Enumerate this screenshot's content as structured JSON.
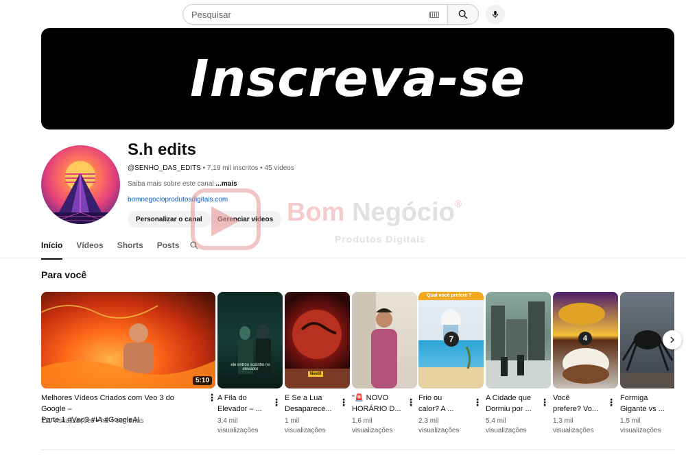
{
  "search": {
    "placeholder": "Pesquisar"
  },
  "banner": {
    "text": "Inscreva-se"
  },
  "channel": {
    "name": "S.h edits",
    "handle": "@SENHO_DAS_EDITS",
    "subscribers": "7,19 mil inscritos",
    "videos_count": "45 vídeos",
    "separator": " • ",
    "about": "Saiba mais sobre este canal ",
    "about_more": "...mais",
    "link": "bomnegocioprodutosdigitais.com",
    "customize_label": "Personalizar o canal",
    "manage_label": "Gerenciar vídeos"
  },
  "watermark": {
    "brand_part1": "Bom ",
    "brand_part2": "Negócio",
    "registered": "®",
    "subtitle": "Produtos Digitais"
  },
  "tabs": [
    "Início",
    "Vídeos",
    "Shorts",
    "Posts"
  ],
  "section": {
    "title": "Para você"
  },
  "videos": [
    {
      "title_line1": "Melhores Vídeos Criados com Veo 3 do Google –",
      "title_line2": "Parte 1 #Veo3 #IA #GoogleAI",
      "meta_line1": "111 visualizações • há 4 semanas",
      "meta_line2": "",
      "duration": "5:10"
    },
    {
      "title_line1": "A Fila do",
      "title_line2": "Elevador – ...",
      "meta_line1": "3,4 mil",
      "meta_line2": "visualizações",
      "overlay": "ele entrou sozinho no elevador"
    },
    {
      "title_line1": "E Se a Lua",
      "title_line2": "Desaparece...",
      "meta_line1": "1 mil",
      "meta_line2": "visualizações",
      "overlay": "Nestil"
    },
    {
      "title_line1": "\"🚨 NOVO",
      "title_line2": "HORÁRIO D...",
      "meta_line1": "1,6 mil",
      "meta_line2": "visualizações"
    },
    {
      "title_line1": "Frio ou",
      "title_line2": "calor? A ...",
      "meta_line1": "2,3 mil",
      "meta_line2": "visualizações",
      "overlay": "Qual você prefere ?",
      "number": "7"
    },
    {
      "title_line1": "A Cidade que",
      "title_line2": "Dormiu por ...",
      "meta_line1": "5,4 mil",
      "meta_line2": "visualizações"
    },
    {
      "title_line1": "Você",
      "title_line2": "prefere? Vo...",
      "meta_line1": "1,3 mil",
      "meta_line2": "visualizações",
      "number": "4"
    },
    {
      "title_line1": "Formiga",
      "title_line2": "Gigante vs ...",
      "meta_line1": "1,5 mil",
      "meta_line2": "visualizações"
    }
  ],
  "colors": {
    "accent_link": "#065fd4",
    "banner_bg": "#000000",
    "chip_bg": "#f2f2f2"
  }
}
